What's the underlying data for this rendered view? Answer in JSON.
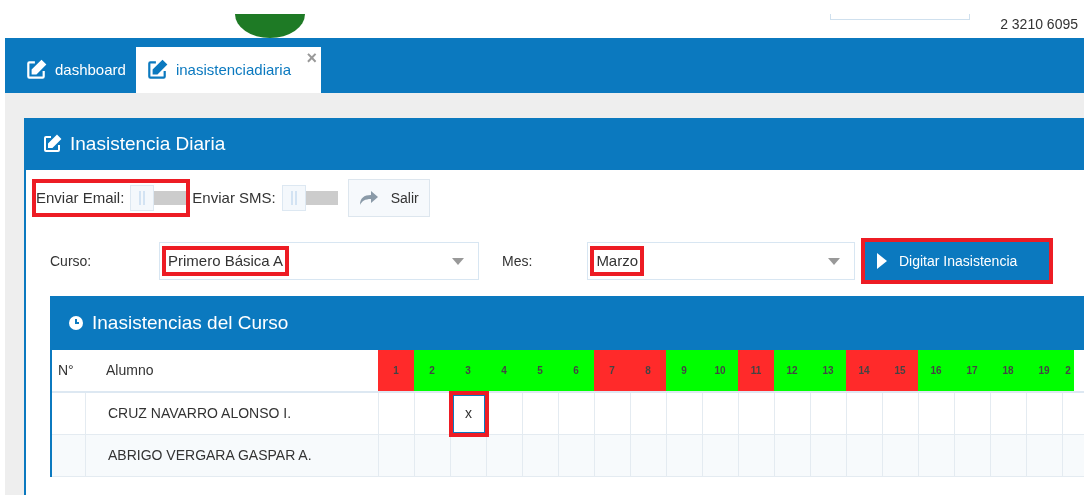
{
  "header": {
    "phone": "2 3210 6095"
  },
  "tabs": [
    {
      "label": "dashboard",
      "selected": false
    },
    {
      "label": "inasistenciadiaria",
      "selected": true,
      "close_glyph": "×"
    }
  ],
  "panel": {
    "title": "Inasistencia Diaria",
    "toggles": [
      {
        "label": "Enviar Email:",
        "on": false,
        "highlighted": true
      },
      {
        "label": "Enviar SMS:",
        "on": false
      }
    ],
    "exit_button": "Salir",
    "filters": [
      {
        "label": "Curso:",
        "value": "Primero Básica A",
        "highlighted": true
      },
      {
        "label": "Mes:",
        "value": "Marzo",
        "highlighted": true
      }
    ],
    "action_button": {
      "label": "Digitar Inasistencia",
      "highlighted": true
    },
    "table_panel": {
      "title": "Inasistencias del Curso",
      "columns": [
        "N°",
        "Alumno"
      ],
      "days": [
        {
          "label": "1",
          "color": "#ff2a2a"
        },
        {
          "label": "2",
          "color": "#00ff00"
        },
        {
          "label": "3",
          "color": "#00ff00"
        },
        {
          "label": "4",
          "color": "#00ff00"
        },
        {
          "label": "5",
          "color": "#00ff00"
        },
        {
          "label": "6",
          "color": "#00ff00"
        },
        {
          "label": "7",
          "color": "#ff2a2a"
        },
        {
          "label": "8",
          "color": "#ff2a2a"
        },
        {
          "label": "9",
          "color": "#00ff00"
        },
        {
          "label": "10",
          "color": "#00ff00"
        },
        {
          "label": "11",
          "color": "#ff2a2a"
        },
        {
          "label": "12",
          "color": "#00ff00"
        },
        {
          "label": "13",
          "color": "#00ff00"
        },
        {
          "label": "14",
          "color": "#ff2a2a"
        },
        {
          "label": "15",
          "color": "#ff2a2a"
        },
        {
          "label": "16",
          "color": "#00ff00"
        },
        {
          "label": "17",
          "color": "#00ff00"
        },
        {
          "label": "18",
          "color": "#00ff00"
        },
        {
          "label": "19",
          "color": "#00ff00"
        },
        {
          "label": "2",
          "color": "#00ff00"
        }
      ],
      "rows": [
        {
          "name": "CRUZ NAVARRO ALONSO I.",
          "cells": [
            {
              "kind": "blank"
            },
            {
              "kind": "blank"
            },
            {
              "kind": "input",
              "value": "x",
              "highlighted": true
            },
            {
              "kind": "blank"
            },
            {
              "kind": "blank"
            },
            {
              "kind": "blank"
            },
            {
              "kind": "blank"
            },
            {
              "kind": "blank"
            },
            {
              "kind": "blank"
            },
            {
              "kind": "blank"
            },
            {
              "kind": "blank"
            },
            {
              "kind": "blank"
            },
            {
              "kind": "blank"
            },
            {
              "kind": "blank"
            },
            {
              "kind": "blank"
            },
            {
              "kind": "blank"
            },
            {
              "kind": "blank"
            },
            {
              "kind": "blank"
            },
            {
              "kind": "blank"
            },
            {
              "kind": "blank"
            }
          ]
        },
        {
          "name": "ABRIGO VERGARA GASPAR A.",
          "cells": [
            {
              "kind": "blank"
            },
            {
              "kind": "blank"
            },
            {
              "kind": "blank"
            },
            {
              "kind": "blank"
            },
            {
              "kind": "blank"
            },
            {
              "kind": "blank"
            },
            {
              "kind": "blank"
            },
            {
              "kind": "blank"
            },
            {
              "kind": "blank"
            },
            {
              "kind": "blank"
            },
            {
              "kind": "blank"
            },
            {
              "kind": "blank"
            },
            {
              "kind": "blank"
            },
            {
              "kind": "blank"
            },
            {
              "kind": "blank"
            },
            {
              "kind": "blank"
            },
            {
              "kind": "blank"
            },
            {
              "kind": "blank"
            },
            {
              "kind": "blank"
            },
            {
              "kind": "blank"
            }
          ]
        }
      ]
    }
  }
}
